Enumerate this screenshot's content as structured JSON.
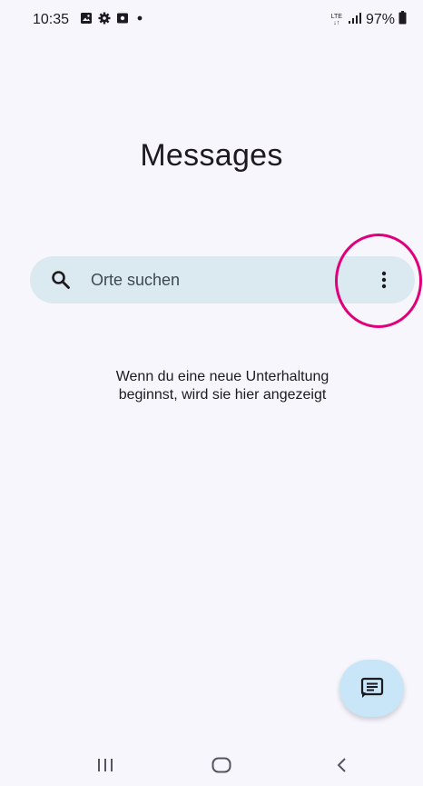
{
  "status_bar": {
    "time": "10:35",
    "network": "LTE",
    "battery": "97%",
    "notification_icons": [
      "image-icon",
      "gear-icon",
      "screen-record-icon",
      "dot-icon"
    ]
  },
  "header": {
    "title": "Messages"
  },
  "search": {
    "placeholder": "Orte suchen"
  },
  "empty_state": {
    "line1": "Wenn du eine neue Unterhaltung",
    "line2": "beginnst, wird sie hier angezeigt"
  },
  "colors": {
    "background": "#f7f6fd",
    "search_bar": "#dbe9f0",
    "fab": "#c8e6f7",
    "annotation": "#e0007a"
  }
}
